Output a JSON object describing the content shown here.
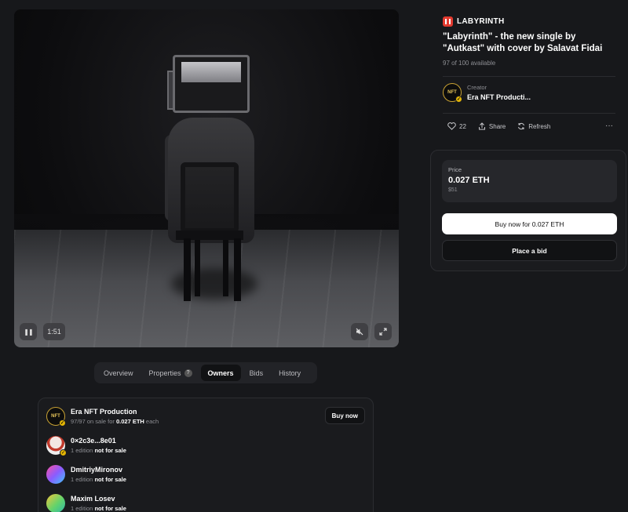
{
  "media": {
    "duration": "1:51"
  },
  "tabs": [
    {
      "label": "Overview"
    },
    {
      "label": "Properties",
      "badge": "?"
    },
    {
      "label": "Owners",
      "active": true
    },
    {
      "label": "Bids"
    },
    {
      "label": "History"
    }
  ],
  "owners": {
    "buy_now_label": "Buy now",
    "list": [
      {
        "name": "Era NFT Production",
        "sub_prefix": "97/97 on sale for",
        "sub_bold": "0.027 ETH",
        "sub_suffix": "each",
        "avatar_text": "NFT"
      },
      {
        "name": "0×2c3e...8e01",
        "sub_prefix": "1 edition",
        "sub_bold": "not for sale"
      },
      {
        "name": "DmitriyMironov",
        "sub_prefix": "1 edition",
        "sub_bold": "not for sale"
      },
      {
        "name": "Maxim Losev",
        "sub_prefix": "1 edition",
        "sub_bold": "not for sale"
      }
    ]
  },
  "collection": {
    "name": "LABYRINTH"
  },
  "item": {
    "title": "\"Labyrinth\" - the new single by \"Autkast\" with cover by Salavat Fidai",
    "availability": "97 of 100 available"
  },
  "creator": {
    "label": "Creator",
    "name": "Era NFT Producti...",
    "avatar_text": "NFT"
  },
  "actions": {
    "likes": "22",
    "share": "Share",
    "refresh": "Refresh",
    "more": "···"
  },
  "price": {
    "label": "Price",
    "eth": "0.027 ETH",
    "usd": "$51",
    "buy_button": "Buy now for 0.027 ETH",
    "bid_button": "Place a bid"
  },
  "colors": {
    "background": "#17181b",
    "verified": "#e3b505",
    "brand_red": "#e23a2f"
  }
}
